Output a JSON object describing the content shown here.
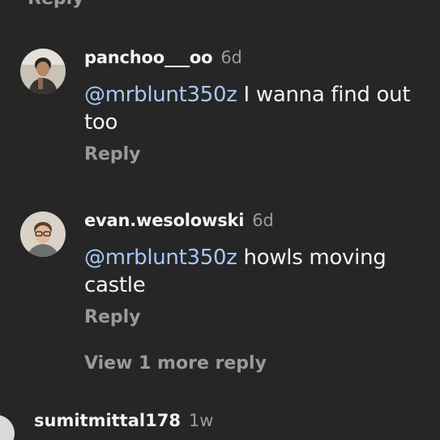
{
  "previous": {
    "reply_label": "Reply"
  },
  "comments": [
    {
      "username": "panchoo___oo",
      "time": "6d",
      "mention": "@mrblunt350z",
      "text": " I wanna find out too",
      "reply_label": "Reply"
    },
    {
      "username": "evan.wesolowski",
      "time": "6d",
      "mention": "@mrblunt350z",
      "text": " howls moving castle",
      "reply_label": "Reply"
    }
  ],
  "view_more_label": "View 1 more reply",
  "next_comment": {
    "username": "sumitmittal178",
    "time": "1w"
  },
  "colors": {
    "background": "#262626",
    "mention": "#a8c7fa",
    "secondary_text": "#9a9a9a"
  }
}
